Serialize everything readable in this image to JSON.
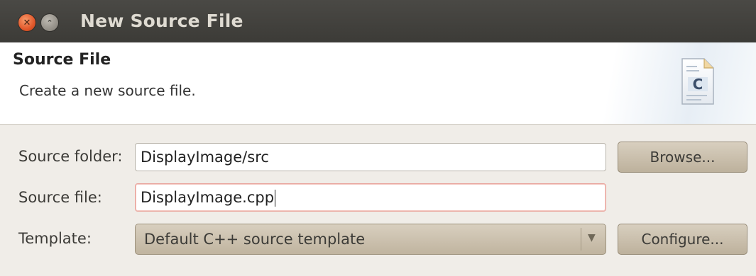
{
  "window": {
    "title": "New Source File",
    "close_glyph": "✕",
    "maximize_glyph": "⌃"
  },
  "banner": {
    "title": "Source File",
    "description": "Create a new source file.",
    "icon": "c-source-file-icon",
    "icon_letter": "C"
  },
  "form": {
    "source_folder": {
      "label": "Source folder:",
      "value": "DisplayImage/src",
      "button_label": "Browse..."
    },
    "source_file": {
      "label": "Source file:",
      "value": "DisplayImage.cpp"
    },
    "template": {
      "label": "Template:",
      "selected": "Default C++ source template",
      "button_label": "Configure..."
    }
  },
  "colors": {
    "titlebar": "#3c3b37",
    "close_button": "#e2582b",
    "button_face": "#c9bea9",
    "focus_border": "#e9a29a"
  }
}
